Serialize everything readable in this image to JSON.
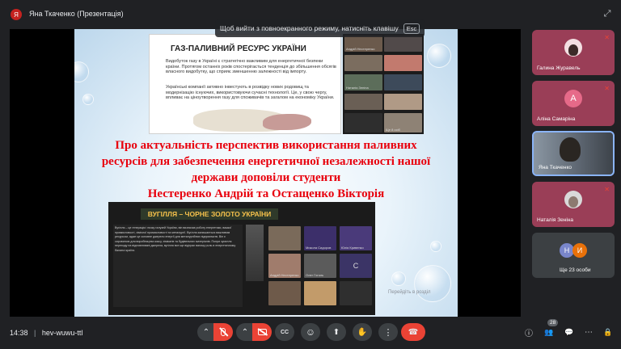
{
  "presenter": {
    "initial": "Я",
    "title": "Яна Ткаченко (Презентація)"
  },
  "fullscreen_hint": {
    "text": "Щоб вийти з повноекранного режиму, натисніть клавішу",
    "key": "Esc"
  },
  "slide": {
    "shot1": {
      "title": "ГАЗ-ПАЛИВНИЙ РЕСУРС УКРАЇНИ",
      "bullet1": "Видобуток газу в Україні є стратегічно важливим для енергетичної безпеки країни. Протягом останніх років спостерігається тенденція до збільшення обсягів власного видобутку, що сприяє зменшенню залежності від імпорту.",
      "bullet2": "Українські компанії активно інвестують в розвідку нових родовищ та модернізацію існуючих, використовуючи сучасні технології. Це, у свою чергу, впливає на ціноутворення газу для споживачів та загалом на економіку України.",
      "tiles": [
        "Андрій Нестеренко",
        "",
        "",
        "",
        "Наталія Зеніна",
        "",
        "",
        "",
        "",
        "Ще 8 осіб"
      ]
    },
    "headline": [
      "Про актуальність перспектив використання паливних",
      "ресурсів для забезпечення енергетичної незалежності нашої",
      "держави доповіли студенти",
      "Нестеренко Андрій та Остащенко Вікторія"
    ],
    "shot2": {
      "title": "ВУГІЛЛЯ – ЧОРНЕ ЗОЛОТО УКРАЇНИ",
      "text": "Вугілля – це генерація і низку галузей України, він визначає роботу енергетики, важкої промисловості, хімічної промисловості та металургії. Вугілля залишається важливим ресурсом, адже це основне джерело енергії для металургійних підприємств. Він є сировиною для виробництва коксу, хімікатів та будівельних матеріалів. Попри зусилля переходу на відновлювані джерела, вугілля все ще відіграє вагому роль в енергетичному балансі країни.",
      "tiles": [
        "",
        "Микола Сидоров",
        "Юлія Кривенко",
        "Андрій Нестеренко",
        "Олег Гоголь",
        "С",
        "",
        "",
        ""
      ]
    },
    "ghost_text": "Перейдіть в розділ"
  },
  "participants": [
    {
      "name": "Галина Журавель",
      "type": "photo",
      "bg": "#9a3e57",
      "muted": true
    },
    {
      "name": "Аліна Самаріна",
      "type": "letter",
      "letter": "А",
      "letter_bg": "#e66a89",
      "bg": "#9a3e57",
      "muted": true
    },
    {
      "name": "Яна Ткаченко",
      "type": "video",
      "bg": "#6d7884",
      "muted": false
    },
    {
      "name": "Наталія Зеніна",
      "type": "photo",
      "bg": "#9a3e57",
      "muted": true
    },
    {
      "name": "Ще 23 особи",
      "type": "others",
      "letters": [
        "Н",
        "И"
      ],
      "bg": "#3c4043",
      "muted": false
    }
  ],
  "bottom": {
    "time": "14:38",
    "separator": "|",
    "meeting_code": "hev-wuwu-ttl",
    "participant_count": "28"
  },
  "icons": {
    "expand": "⤢",
    "chevron_up": "⌃",
    "mic_off": "🎙",
    "cam_off": "▭",
    "captions": "CC",
    "emoji": "☺",
    "present": "⬆",
    "hand": "✋",
    "more": "⋮",
    "end_call": "☎",
    "info": "ⓘ",
    "people": "👥",
    "chat": "💬",
    "activities": "⋯",
    "lock": "🔒",
    "mic_muted_small": "✕"
  },
  "colors": {
    "end_call_bg": "#ea4335",
    "mic_off_bg": "#ea4335",
    "headline_red": "#e8000d"
  }
}
